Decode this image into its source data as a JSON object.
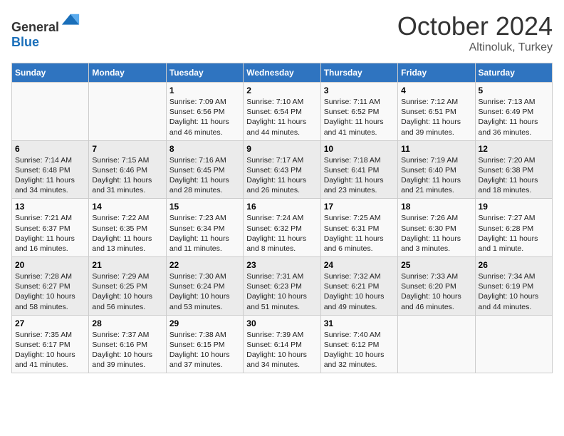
{
  "header": {
    "logo_general": "General",
    "logo_blue": "Blue",
    "month": "October 2024",
    "location": "Altinoluk, Turkey"
  },
  "days_of_week": [
    "Sunday",
    "Monday",
    "Tuesday",
    "Wednesday",
    "Thursday",
    "Friday",
    "Saturday"
  ],
  "weeks": [
    [
      {
        "day": "",
        "sunrise": "",
        "sunset": "",
        "daylight": ""
      },
      {
        "day": "",
        "sunrise": "",
        "sunset": "",
        "daylight": ""
      },
      {
        "day": "1",
        "sunrise": "Sunrise: 7:09 AM",
        "sunset": "Sunset: 6:56 PM",
        "daylight": "Daylight: 11 hours and 46 minutes."
      },
      {
        "day": "2",
        "sunrise": "Sunrise: 7:10 AM",
        "sunset": "Sunset: 6:54 PM",
        "daylight": "Daylight: 11 hours and 44 minutes."
      },
      {
        "day": "3",
        "sunrise": "Sunrise: 7:11 AM",
        "sunset": "Sunset: 6:52 PM",
        "daylight": "Daylight: 11 hours and 41 minutes."
      },
      {
        "day": "4",
        "sunrise": "Sunrise: 7:12 AM",
        "sunset": "Sunset: 6:51 PM",
        "daylight": "Daylight: 11 hours and 39 minutes."
      },
      {
        "day": "5",
        "sunrise": "Sunrise: 7:13 AM",
        "sunset": "Sunset: 6:49 PM",
        "daylight": "Daylight: 11 hours and 36 minutes."
      }
    ],
    [
      {
        "day": "6",
        "sunrise": "Sunrise: 7:14 AM",
        "sunset": "Sunset: 6:48 PM",
        "daylight": "Daylight: 11 hours and 34 minutes."
      },
      {
        "day": "7",
        "sunrise": "Sunrise: 7:15 AM",
        "sunset": "Sunset: 6:46 PM",
        "daylight": "Daylight: 11 hours and 31 minutes."
      },
      {
        "day": "8",
        "sunrise": "Sunrise: 7:16 AM",
        "sunset": "Sunset: 6:45 PM",
        "daylight": "Daylight: 11 hours and 28 minutes."
      },
      {
        "day": "9",
        "sunrise": "Sunrise: 7:17 AM",
        "sunset": "Sunset: 6:43 PM",
        "daylight": "Daylight: 11 hours and 26 minutes."
      },
      {
        "day": "10",
        "sunrise": "Sunrise: 7:18 AM",
        "sunset": "Sunset: 6:41 PM",
        "daylight": "Daylight: 11 hours and 23 minutes."
      },
      {
        "day": "11",
        "sunrise": "Sunrise: 7:19 AM",
        "sunset": "Sunset: 6:40 PM",
        "daylight": "Daylight: 11 hours and 21 minutes."
      },
      {
        "day": "12",
        "sunrise": "Sunrise: 7:20 AM",
        "sunset": "Sunset: 6:38 PM",
        "daylight": "Daylight: 11 hours and 18 minutes."
      }
    ],
    [
      {
        "day": "13",
        "sunrise": "Sunrise: 7:21 AM",
        "sunset": "Sunset: 6:37 PM",
        "daylight": "Daylight: 11 hours and 16 minutes."
      },
      {
        "day": "14",
        "sunrise": "Sunrise: 7:22 AM",
        "sunset": "Sunset: 6:35 PM",
        "daylight": "Daylight: 11 hours and 13 minutes."
      },
      {
        "day": "15",
        "sunrise": "Sunrise: 7:23 AM",
        "sunset": "Sunset: 6:34 PM",
        "daylight": "Daylight: 11 hours and 11 minutes."
      },
      {
        "day": "16",
        "sunrise": "Sunrise: 7:24 AM",
        "sunset": "Sunset: 6:32 PM",
        "daylight": "Daylight: 11 hours and 8 minutes."
      },
      {
        "day": "17",
        "sunrise": "Sunrise: 7:25 AM",
        "sunset": "Sunset: 6:31 PM",
        "daylight": "Daylight: 11 hours and 6 minutes."
      },
      {
        "day": "18",
        "sunrise": "Sunrise: 7:26 AM",
        "sunset": "Sunset: 6:30 PM",
        "daylight": "Daylight: 11 hours and 3 minutes."
      },
      {
        "day": "19",
        "sunrise": "Sunrise: 7:27 AM",
        "sunset": "Sunset: 6:28 PM",
        "daylight": "Daylight: 11 hours and 1 minute."
      }
    ],
    [
      {
        "day": "20",
        "sunrise": "Sunrise: 7:28 AM",
        "sunset": "Sunset: 6:27 PM",
        "daylight": "Daylight: 10 hours and 58 minutes."
      },
      {
        "day": "21",
        "sunrise": "Sunrise: 7:29 AM",
        "sunset": "Sunset: 6:25 PM",
        "daylight": "Daylight: 10 hours and 56 minutes."
      },
      {
        "day": "22",
        "sunrise": "Sunrise: 7:30 AM",
        "sunset": "Sunset: 6:24 PM",
        "daylight": "Daylight: 10 hours and 53 minutes."
      },
      {
        "day": "23",
        "sunrise": "Sunrise: 7:31 AM",
        "sunset": "Sunset: 6:23 PM",
        "daylight": "Daylight: 10 hours and 51 minutes."
      },
      {
        "day": "24",
        "sunrise": "Sunrise: 7:32 AM",
        "sunset": "Sunset: 6:21 PM",
        "daylight": "Daylight: 10 hours and 49 minutes."
      },
      {
        "day": "25",
        "sunrise": "Sunrise: 7:33 AM",
        "sunset": "Sunset: 6:20 PM",
        "daylight": "Daylight: 10 hours and 46 minutes."
      },
      {
        "day": "26",
        "sunrise": "Sunrise: 7:34 AM",
        "sunset": "Sunset: 6:19 PM",
        "daylight": "Daylight: 10 hours and 44 minutes."
      }
    ],
    [
      {
        "day": "27",
        "sunrise": "Sunrise: 7:35 AM",
        "sunset": "Sunset: 6:17 PM",
        "daylight": "Daylight: 10 hours and 41 minutes."
      },
      {
        "day": "28",
        "sunrise": "Sunrise: 7:37 AM",
        "sunset": "Sunset: 6:16 PM",
        "daylight": "Daylight: 10 hours and 39 minutes."
      },
      {
        "day": "29",
        "sunrise": "Sunrise: 7:38 AM",
        "sunset": "Sunset: 6:15 PM",
        "daylight": "Daylight: 10 hours and 37 minutes."
      },
      {
        "day": "30",
        "sunrise": "Sunrise: 7:39 AM",
        "sunset": "Sunset: 6:14 PM",
        "daylight": "Daylight: 10 hours and 34 minutes."
      },
      {
        "day": "31",
        "sunrise": "Sunrise: 7:40 AM",
        "sunset": "Sunset: 6:12 PM",
        "daylight": "Daylight: 10 hours and 32 minutes."
      },
      {
        "day": "",
        "sunrise": "",
        "sunset": "",
        "daylight": ""
      },
      {
        "day": "",
        "sunrise": "",
        "sunset": "",
        "daylight": ""
      }
    ]
  ]
}
